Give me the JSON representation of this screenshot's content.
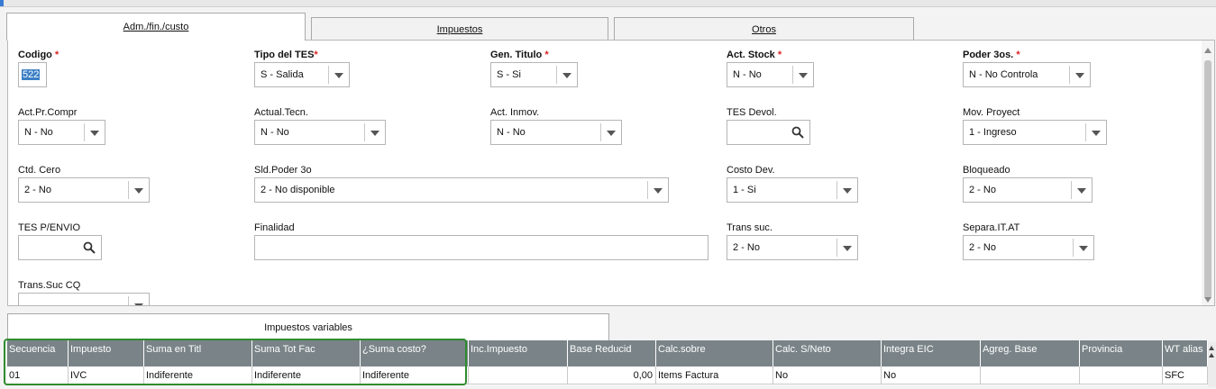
{
  "tabs": [
    {
      "label": "Adm./fin./custo",
      "active": true
    },
    {
      "label": "Impuestos",
      "active": false
    },
    {
      "label": "Otros",
      "active": false
    }
  ],
  "form": {
    "codigo": {
      "label": "Codigo",
      "value": "522"
    },
    "tipo_tes": {
      "label": "Tipo del TES",
      "value": "S - Salida"
    },
    "gen_titulo": {
      "label": "Gen. Titulo",
      "value": "S - Si"
    },
    "act_stock": {
      "label": "Act. Stock",
      "value": "N - No"
    },
    "poder_3os": {
      "label": "Poder 3os.",
      "value": "N - No Controla"
    },
    "act_pr_compr": {
      "label": "Act.Pr.Compr",
      "value": "N - No"
    },
    "actual_tecn": {
      "label": "Actual.Tecn.",
      "value": "N - No"
    },
    "act_inmov": {
      "label": "Act. Inmov.",
      "value": "N - No"
    },
    "tes_devol": {
      "label": "TES Devol.",
      "value": ""
    },
    "mov_proyect": {
      "label": "Mov. Proyect",
      "value": "1 - Ingreso"
    },
    "ctd_cero": {
      "label": "Ctd. Cero",
      "value": "2 - No"
    },
    "sld_poder_3o": {
      "label": "Sld.Poder 3o",
      "value": "2 - No disponible"
    },
    "costo_dev": {
      "label": "Costo Dev.",
      "value": "1 - Si"
    },
    "bloqueado": {
      "label": "Bloqueado",
      "value": "2 - No"
    },
    "tes_p_envio": {
      "label": "TES P/ENVIO",
      "value": ""
    },
    "finalidad": {
      "label": "Finalidad",
      "value": ""
    },
    "trans_suc": {
      "label": "Trans suc.",
      "value": "2 - No"
    },
    "separa_it_at": {
      "label": "Separa.IT.AT",
      "value": "2 - No"
    },
    "trans_suc_cq": {
      "label": "Trans.Suc CQ",
      "value": ""
    }
  },
  "subtab": {
    "label": "Impuestos variables"
  },
  "grid": {
    "headers": [
      "Secuencia",
      "Impuesto",
      "Suma en Titl",
      "Suma Tot Fac",
      "¿Suma costo?",
      "Inc.Impuesto",
      "Base Reducid",
      "Calc.sobre",
      "Calc. S/Neto",
      "Integra EIC",
      "Agreg. Base",
      "Provincia",
      "WT alias"
    ],
    "rows": [
      [
        "01",
        "IVC",
        "Indiferente",
        "Indiferente",
        "Indiferente",
        "",
        "0,00",
        "Items Factura",
        "No",
        "No",
        "",
        "",
        "SFC"
      ]
    ]
  },
  "colors": {
    "header_bg": "#7a8488",
    "highlight": "#2f8c2f",
    "required": "#d22"
  }
}
